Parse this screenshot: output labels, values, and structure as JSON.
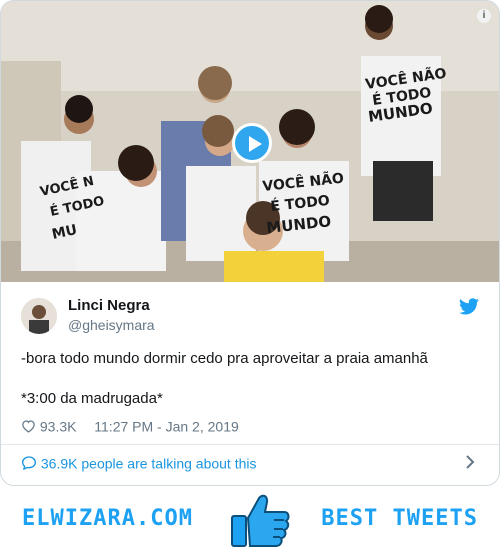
{
  "tweet": {
    "author_name": "Linci Negra",
    "author_handle": "@gheisymara",
    "text_line1": "-bora todo mundo dormir cedo pra aproveitar a praia amanhã",
    "text_line2": "*3:00 da madrugada*",
    "likes": "93.3K",
    "timestamp": "11:27 PM - Jan 2, 2019",
    "talking": "36.9K people are talking about this"
  },
  "media": {
    "shirt_text": "VOCÊ NÃO É TODO MUNDO",
    "info_label": "i"
  },
  "footer": {
    "left_brand": "ELWIZARA.COM",
    "right_brand": "BEST TWEETS"
  },
  "colors": {
    "accent": "#1da1f2",
    "link": "#1b95e0",
    "text": "#14171a",
    "muted": "#657786"
  }
}
